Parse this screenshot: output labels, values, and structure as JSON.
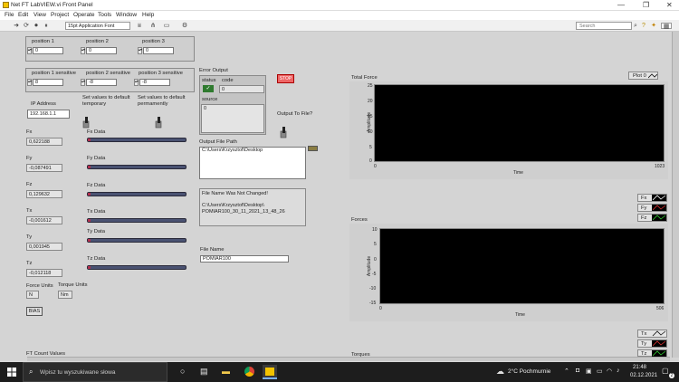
{
  "window": {
    "title": "Net FT LabVIEW.vi Front Panel",
    "minimize": "—",
    "maximize": "❐",
    "close": "✕"
  },
  "menu": [
    "File",
    "Edit",
    "View",
    "Project",
    "Operate",
    "Tools",
    "Window",
    "Help"
  ],
  "toolbar": {
    "font": "15pt Application Font",
    "search_placeholder": "Search",
    "help": "?"
  },
  "positions": {
    "labels": [
      "position 1",
      "position 2",
      "position 3"
    ],
    "values": [
      "0",
      "0",
      "0"
    ]
  },
  "sensitive": {
    "labels": [
      "position 1 sensitive",
      "position 2 sensitive",
      "position 3 sensitive"
    ],
    "values": [
      "8",
      "-8",
      "-8"
    ]
  },
  "ip": {
    "label": "IP Address",
    "value": "192.168.1.1"
  },
  "defaults": {
    "temporary": "Set values to default temporary",
    "permanently": "Set values to default permamently"
  },
  "axes": [
    {
      "label": "Fx",
      "value": "0,622188",
      "data": "Fx Data"
    },
    {
      "label": "Fy",
      "value": "-0,087491",
      "data": "Fy Data"
    },
    {
      "label": "Fz",
      "value": "0,129632",
      "data": "Fz Data"
    },
    {
      "label": "Tx",
      "value": "-0,001612",
      "data": "Tx Data"
    },
    {
      "label": "Ty",
      "value": "0,001945",
      "data": "Ty Data"
    },
    {
      "label": "Tz",
      "value": "-0,012118",
      "data": "Tz Data"
    }
  ],
  "units": {
    "force_label": "Force Units",
    "force": "N",
    "torque_label": "Torque Units",
    "torque": "Nm"
  },
  "bias": "BIAS",
  "ft_count": "FT Count Values",
  "error": {
    "title": "Error Output",
    "status": "status",
    "code": "code",
    "code_value": "0",
    "source": "source",
    "source_value": "0"
  },
  "stop": "STOP",
  "output_to_file": "Output To File?",
  "output_path": {
    "label": "Output File Path",
    "value": "C:\\Users\\Krzysztof\\Desktop"
  },
  "file_msg": {
    "title": "File Name Was Not Changed!",
    "path1": "C:\\Users\\Krzysztof\\Desktop\\",
    "path2": "POMIAR100_30_11_2021_13_48_26"
  },
  "file_name": {
    "label": "File Name",
    "value": "POMIAR100"
  },
  "legend_total": [
    "Plot 0"
  ],
  "legend_forces": [
    "Fx",
    "Fy",
    "Fz"
  ],
  "legend_torques": [
    "Tx",
    "Ty",
    "Tz"
  ],
  "total_force": {
    "title": "Total Force",
    "ylabel": "Amplitude",
    "xlabel": "Time",
    "yticks": [
      "25",
      "20",
      "15",
      "10",
      "5",
      "0"
    ],
    "xticks": [
      "0",
      "1023"
    ]
  },
  "forces": {
    "title": "Forces",
    "ylabel": "Amplitude",
    "xlabel": "Time",
    "yticks": [
      "10",
      "5",
      "0",
      "-5",
      "-10",
      "-15"
    ],
    "xticks": [
      "0",
      "506"
    ]
  },
  "torques_title": "Torques",
  "taskbar": {
    "search": "Wpisz tu wyszukiwane słowa",
    "weather": "2°C Pochmurnie",
    "time": "21:48",
    "date": "02.12.2021",
    "notif": "2"
  }
}
